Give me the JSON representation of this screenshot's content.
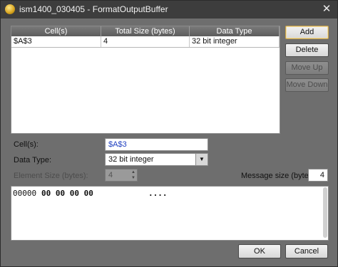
{
  "window": {
    "title": "ism1400_030405 - FormatOutputBuffer",
    "close_glyph": "✕"
  },
  "table": {
    "headers": [
      "Cell(s)",
      "Total Size (bytes)",
      "Data Type"
    ],
    "rows": [
      {
        "cells": "$A$3",
        "total_size": "4",
        "data_type": "32 bit integer"
      }
    ]
  },
  "buttons": {
    "add": "Add",
    "delete": "Delete",
    "move_up": "Move Up",
    "move_down": "Move Down",
    "ok": "OK",
    "cancel": "Cancel"
  },
  "form": {
    "cells_label": "Cell(s):",
    "cells_value": "$A$3",
    "data_type_label": "Data Type:",
    "data_type_value": "32 bit integer",
    "element_size_label": "Element Size (bytes):",
    "element_size_value": "4",
    "message_size_label": "Message size (bytes):",
    "message_size_value": "4"
  },
  "hex_view": {
    "offset": "00000",
    "bytes": "00 00 00 00",
    "ascii": "...."
  },
  "colors": {
    "titlebar": "#3d3d3d",
    "panel": "#6e6e6e",
    "default_button_border": "#c5a04a"
  },
  "icons": {
    "app": "app-icon",
    "close": "close-icon",
    "dropdown": "chevron-down-icon",
    "spin": "spin-arrows-icon"
  }
}
